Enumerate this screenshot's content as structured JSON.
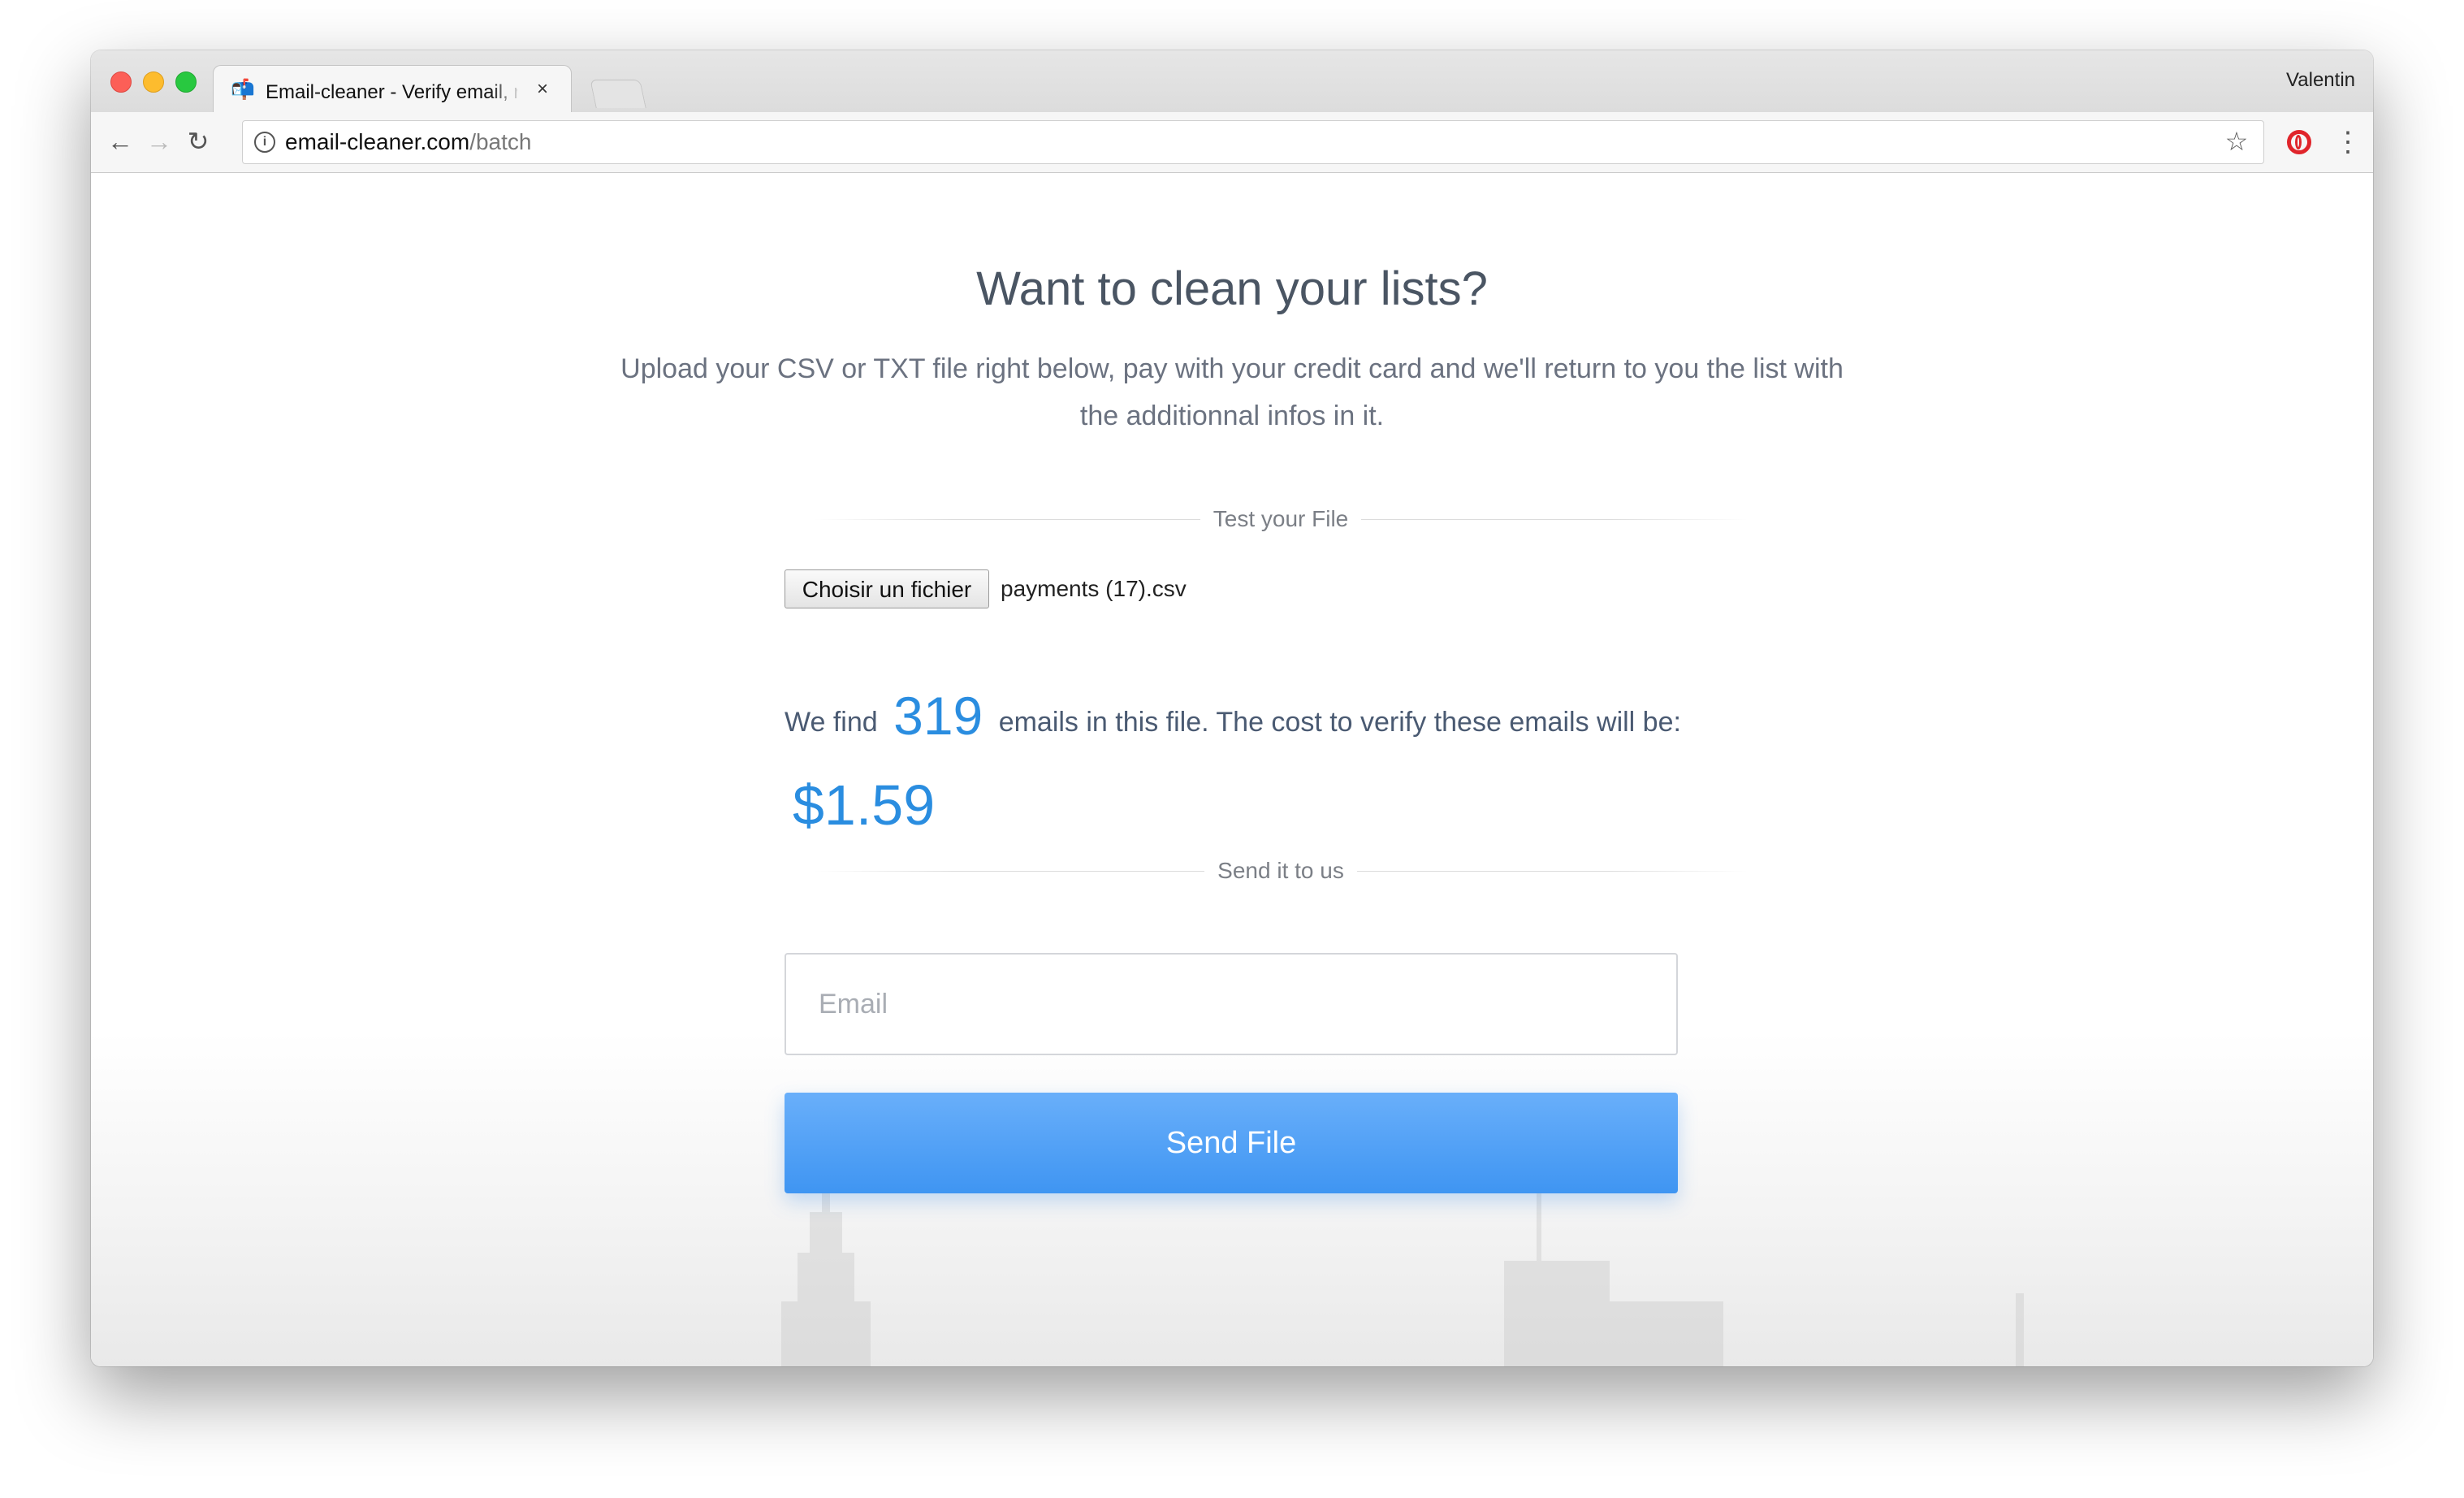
{
  "browser": {
    "tab_title": "Email-cleaner - Verify email, re",
    "tab_close": "×",
    "profile_name": "Valentin",
    "url_host": "email-cleaner.com",
    "url_path": "/batch",
    "nav": {
      "back": "←",
      "forward": "→",
      "reload": "↻"
    },
    "icons": {
      "info": "i",
      "star": "☆",
      "menu": "⋮",
      "favicon": "📬"
    }
  },
  "page": {
    "heading": "Want to clean your lists?",
    "subtitle": "Upload your CSV or TXT file right below, pay with your credit card and we'll return to you the list with the additionnal infos in it.",
    "test_divider": "Test your File",
    "file_button": "Choisir un fichier",
    "file_name": "payments (17).csv",
    "result_prefix": "We find",
    "email_count": "319",
    "result_middle": "emails in this file. The cost to verify these emails will be:",
    "price": "$1.59",
    "send_divider": "Send it to us",
    "email_placeholder": "Email",
    "send_button": "Send File"
  },
  "colors": {
    "accent": "#2a8de0",
    "button": "#4a9cf5",
    "heading": "#4a5563"
  }
}
